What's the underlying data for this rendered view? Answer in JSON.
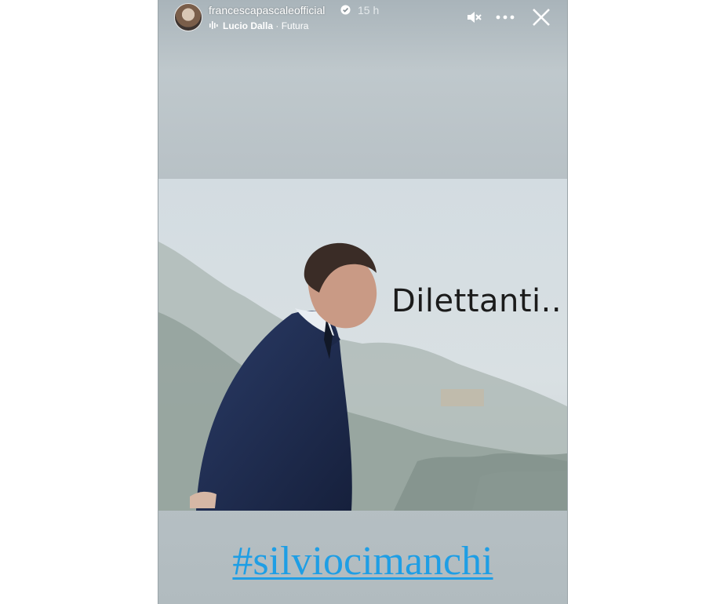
{
  "story": {
    "username": "francescapascaleofficial",
    "verified": true,
    "time": "15 h",
    "music": {
      "artist": "Lucio Dalla",
      "separator": " · ",
      "song": "Futura"
    },
    "icons": {
      "mute": "mute-icon",
      "more": "more-icon",
      "close": "close-icon",
      "verified": "verified-badge-icon",
      "music": "music-bars-icon"
    },
    "caption": "Dilettanti..",
    "hashtag": "#silviocimanchi"
  },
  "colors": {
    "hashtag": "#1e9ee5",
    "background": "#b9c3c8"
  }
}
